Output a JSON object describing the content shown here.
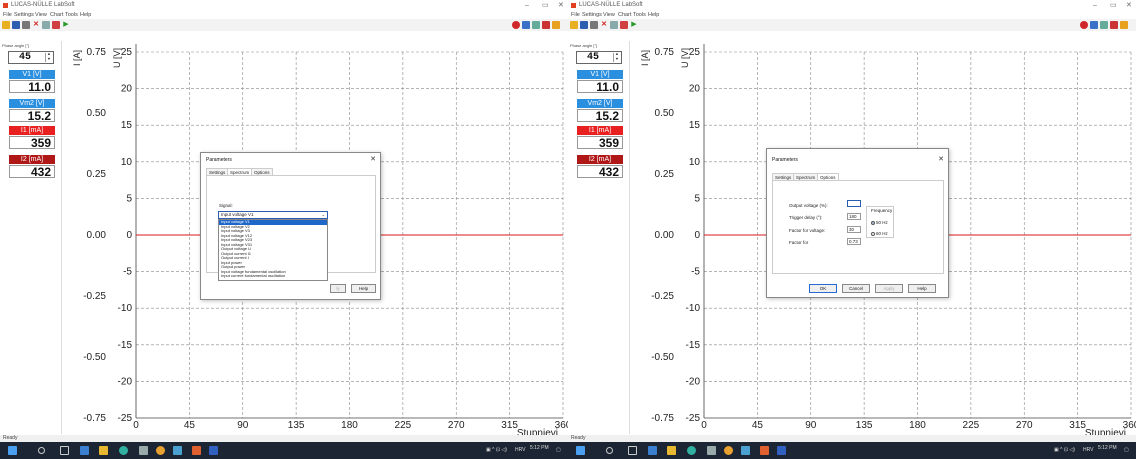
{
  "window": {
    "title": "LUCAS-NÜLLE LabSoft",
    "controls": [
      "–",
      "▭",
      "✕"
    ],
    "menu": [
      "File",
      "Settings",
      "View",
      "Chart",
      "Tools",
      "Help"
    ]
  },
  "sidebar": {
    "phase_label": "Phase angle [°]",
    "phase_value": "45",
    "meters": [
      {
        "label": "V1 [V]",
        "value": "11.0",
        "color": "#2b8fe0"
      },
      {
        "label": "Vm2 [V]",
        "value": "15.2",
        "color": "#2b8fe0"
      },
      {
        "label": "I1 [mA]",
        "value": "359",
        "color": "#e82020"
      },
      {
        "label": "I2 [mA]",
        "value": "432",
        "color": "#b01818"
      }
    ]
  },
  "chart_data": {
    "type": "line",
    "x": [
      0,
      360
    ],
    "series": [
      {
        "values": [
          0,
          0
        ],
        "color": "#d81818"
      }
    ],
    "x_ticks": [
      "0",
      "45",
      "90",
      "135",
      "180",
      "225",
      "270",
      "315",
      "360"
    ],
    "xlabel": "Stupnjevi",
    "xlim": [
      0,
      360
    ],
    "ylabel": "U [V]",
    "ylim": [
      -25,
      25
    ],
    "y_ticks": [
      "25",
      "20",
      "15",
      "10",
      "5",
      "0",
      "-5",
      "-10",
      "-15",
      "-20",
      "-25"
    ],
    "y2label": "I [A]",
    "y2lim": [
      -0.75,
      0.75
    ],
    "y2_ticks": [
      "0.75",
      "0.50",
      "0.25",
      "0.00",
      "-0.25",
      "-0.50",
      "-0.75"
    ],
    "grid": true
  },
  "statusbar": {
    "text": "Ready"
  },
  "taskbar": {
    "tray_lang": "HRV",
    "time": "5:12 PM"
  },
  "dialog_left": {
    "title": "Parameters",
    "tabs": [
      "Settings",
      "Spectrum",
      "Options"
    ],
    "active_tab": "Spectrum",
    "signal_label": "Signal:",
    "selected": "Input voltage V1",
    "options": [
      "Input voltage V1",
      "Input voltage V2",
      "Input voltage V3",
      "Input voltage V12",
      "Input voltage V23",
      "Input voltage V31",
      "Output voltage U",
      "Output current I1",
      "Output current I",
      "Input power",
      "Output power",
      "Input voltage fundamental oscillation",
      "Input current fundamental oscillation"
    ],
    "help_button": "Help",
    "partial_button": "ly"
  },
  "dialog_right": {
    "title": "Parameters",
    "tabs": [
      "Settings",
      "Spectrum",
      "Options"
    ],
    "active_tab": "Options",
    "fields": [
      {
        "label": "Output voltage (%):",
        "value": ""
      },
      {
        "label": "Trigger delay (°):",
        "value": "180"
      },
      {
        "label": "Factor for voltage:",
        "value": "30"
      },
      {
        "label": "Factor for",
        "value": "0.73"
      }
    ],
    "frequency_label": "Frequency",
    "freq_options": [
      "50 Hz",
      "60 Hz"
    ],
    "freq_selected": "50 Hz",
    "buttons": [
      "OK",
      "Cancel",
      "Apply",
      "Help"
    ]
  }
}
